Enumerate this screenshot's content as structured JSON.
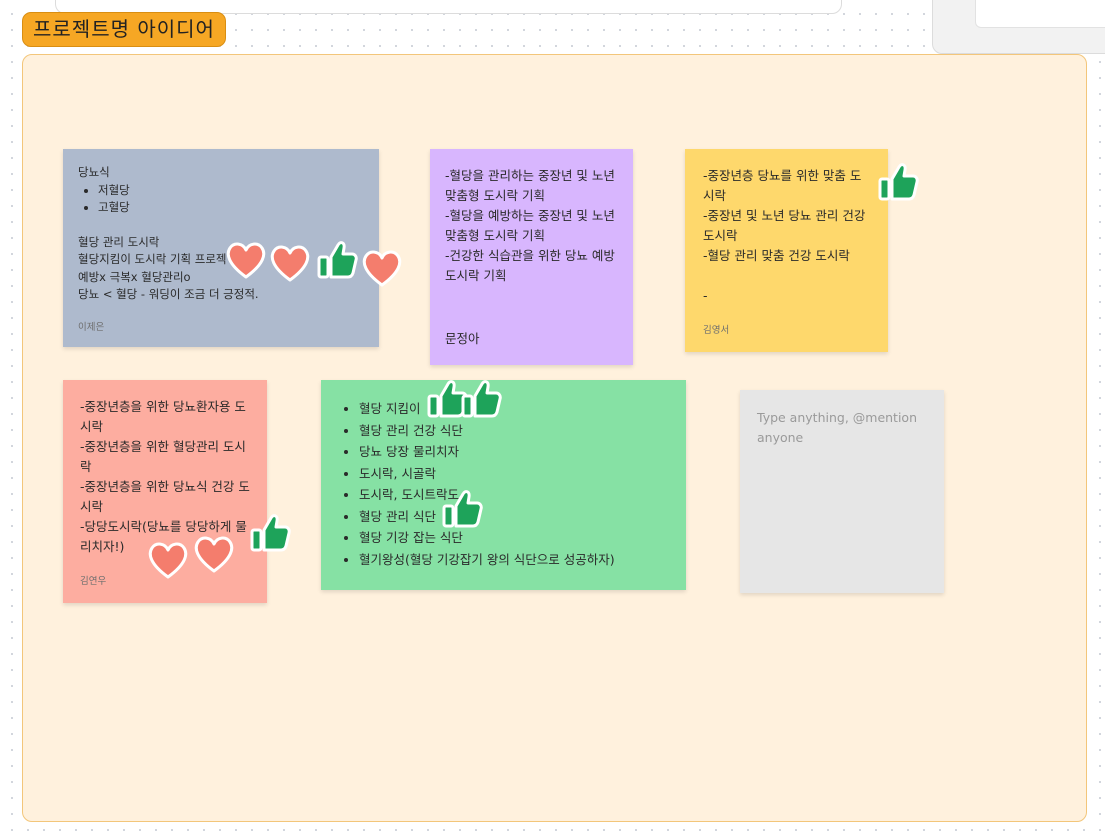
{
  "section": {
    "title": "프로젝트명 아이디어",
    "color": "#f6a724"
  },
  "stickies": {
    "s1": {
      "heading": "당뇨식",
      "bullets": [
        "저혈당",
        "고혈당"
      ],
      "body": "혈당 관리 도시락\n혈당지킴이 도시락 기획 프로젝\n예방x 극복x 혈당관리o\n당뇨 < 혈당 - 워딩이 조금 더 긍정적.",
      "author": "이제은",
      "color": "#aebacd"
    },
    "s2": {
      "body": "-혈당을 관리하는 중장년 및 노년 맞춤형 도시락 기획\n-혈당을 예방하는 중장년 및 노년 맞춤형 도시락 기획\n-건강한 식습관을 위한 당뇨 예방 도시락 기획",
      "signature": "문정아",
      "color": "#d8b6fe"
    },
    "s3": {
      "body": "-중장년층 당뇨를 위한 맞춤 도시락\n-중장년 및 노년 당뇨 관리 건강 도시락\n-혈당 관리 맞춤 건강 도시락\n\n-",
      "author": "김영서",
      "color": "#fed86c"
    },
    "s4": {
      "body": "-중장년층을 위한 당뇨환자용 도시락\n-중장년층을 위한 혈당관리 도시락\n-중장년층을 위한 당뇨식 건강 도시락\n-당당도시락(당뇨를 당당하게 물리치자!)",
      "author": "김연우",
      "color": "#fdada0"
    },
    "s5": {
      "bullets": [
        "혈당 지킴이",
        "혈당 관리 건강 식단",
        "당뇨 당장 물리치자",
        "도시락, 시골락",
        "도시락, 도시트락도",
        "혈당 관리 식단",
        "혈당 기강 잡는 식단",
        "혈기왕성(혈당 기강잡기 왕의 식단으로 성공하자)"
      ],
      "color": "#86e1a4"
    },
    "s6": {
      "placeholder": "Type anything, @mention anyone",
      "color": "#e6e6e6"
    }
  },
  "reactions": {
    "heart_color": "#f47d6d",
    "thumb_color": "#1ea35a",
    "items": [
      {
        "type": "heart-icon",
        "sticky": "s1"
      },
      {
        "type": "heart-icon",
        "sticky": "s1"
      },
      {
        "type": "thumbs-up-icon",
        "sticky": "s1"
      },
      {
        "type": "heart-icon",
        "sticky": "s1"
      },
      {
        "type": "thumbs-up-icon",
        "sticky": "s3"
      },
      {
        "type": "thumbs-up-icon",
        "sticky": "s5"
      },
      {
        "type": "thumbs-up-icon",
        "sticky": "s5"
      },
      {
        "type": "thumbs-up-icon",
        "sticky": "s5"
      },
      {
        "type": "thumbs-up-icon",
        "sticky": "s4"
      },
      {
        "type": "heart-icon",
        "sticky": "s4"
      },
      {
        "type": "heart-icon",
        "sticky": "s4"
      }
    ]
  }
}
